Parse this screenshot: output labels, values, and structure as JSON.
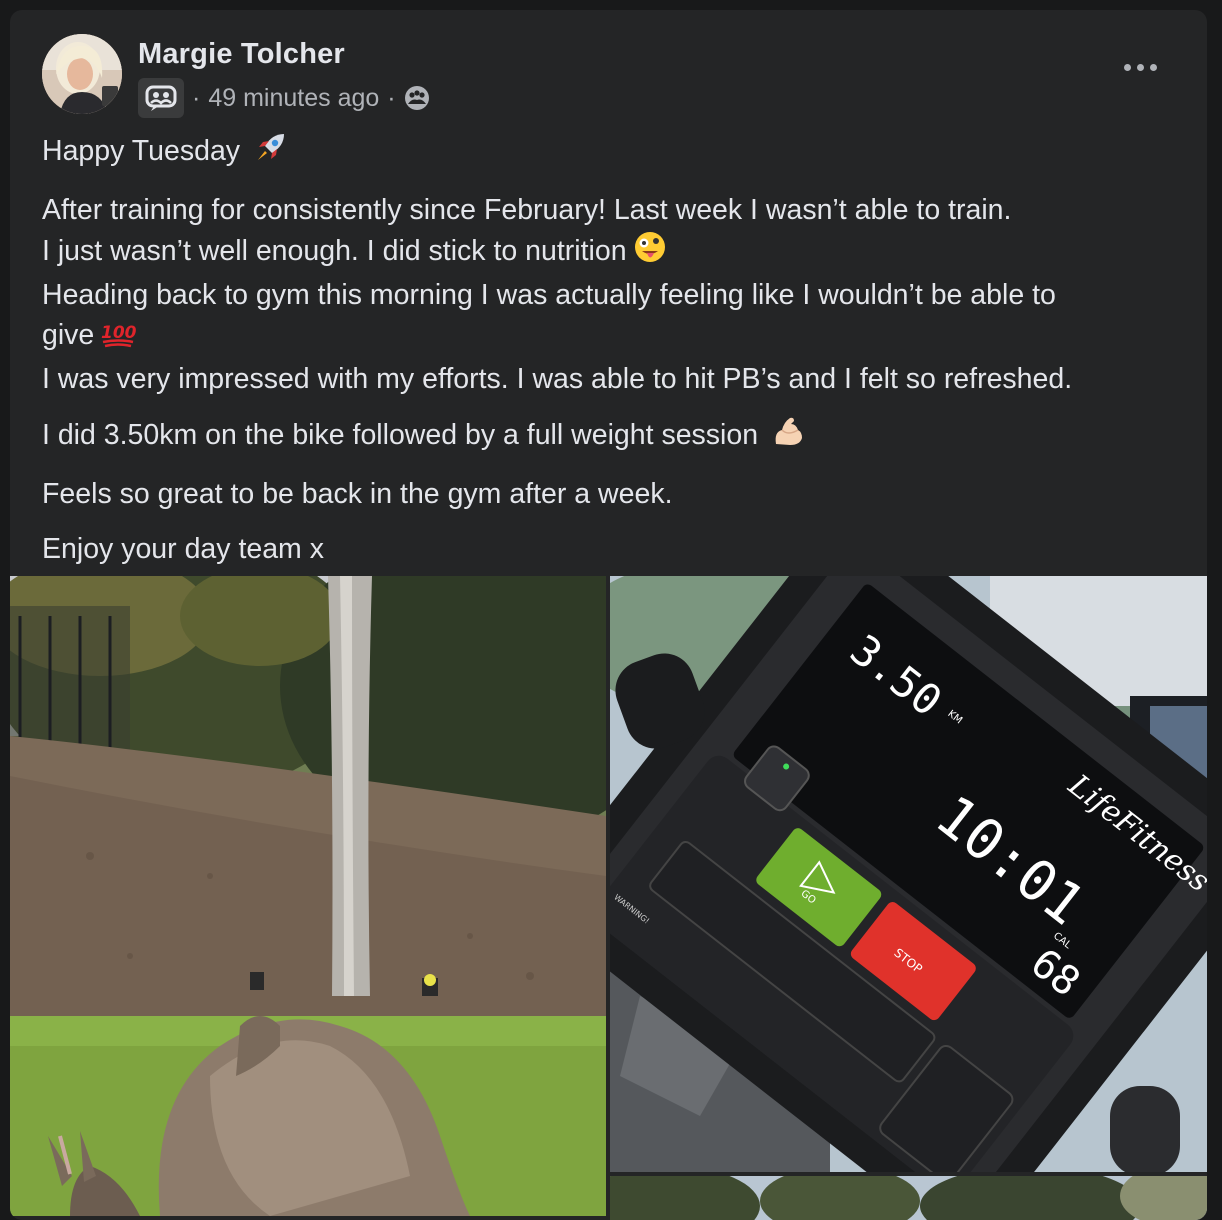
{
  "post": {
    "author": "Margie Tolcher",
    "timestamp": "49 minutes ago",
    "separator": "·",
    "icons": {
      "group": "group-chat-icon",
      "audience": "members-audience-icon",
      "more": "more-options-icon"
    },
    "greeting": "Happy Tuesday",
    "lines": [
      "After training for consistently since February! Last week I wasn’t able to train.",
      "I just wasn’t well enough. I did stick to nutrition",
      "Heading back to gym this morning I was actually feeling like I wouldn’t be able to",
      "give",
      "I was very impressed with my efforts. I was able to hit PB’s and I felt so refreshed."
    ],
    "bike_line": "I did 3.50km on the bike followed by a full weight session",
    "feels_line": "Feels so great to be back in the gym after a week.",
    "closing": "Enjoy your day team x",
    "emojis": {
      "rocket": "rocket-emoji",
      "crazy": "zany-face-emoji",
      "hundred": "hundred-points-emoji",
      "muscle": "flexed-biceps-emoji"
    }
  },
  "photos": {
    "kangaroo": "kangaroo-grazing-photo",
    "bike_console": {
      "distance": "3.50",
      "distance_unit": "KM",
      "time": "10:01",
      "calories": "68",
      "calories_unit": "CAL",
      "brand": "LifeFitness",
      "go_label": "GO",
      "stop_label": "STOP",
      "warning": "WARNING!"
    },
    "trees": "trees-photo"
  },
  "colors": {
    "background": "#18191a",
    "card": "#242526",
    "text_primary": "#e4e6eb",
    "text_secondary": "#b0b3b8",
    "go_button": "#7ab32e",
    "stop_button": "#e0322b"
  }
}
